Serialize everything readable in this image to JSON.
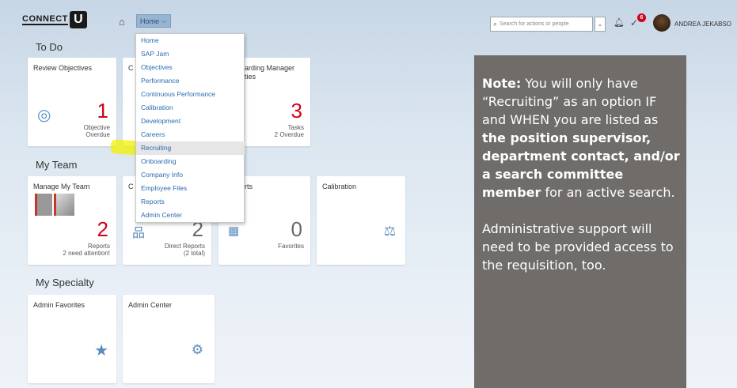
{
  "header": {
    "logo_text": "CONNECT",
    "logo_letter": "U",
    "home_label": "Home",
    "search_placeholder": "Search for actions or people",
    "notification_badge": "6",
    "user_name": "ANDREA JEKABSO"
  },
  "home_menu": {
    "items": [
      "Home",
      "SAP Jam",
      "Objectives",
      "Performance",
      "Continuous Performance",
      "Calibration",
      "Development",
      "Careers",
      "Recruiting",
      "Onboarding",
      "Company Info",
      "Employee Files",
      "Reports",
      "Admin Center"
    ],
    "selected": "Recruiting"
  },
  "sections": {
    "todo": "To Do",
    "team": "My Team",
    "specialty": "My Specialty"
  },
  "tiles": {
    "review_objectives": {
      "title": "Review Objectives",
      "value": "1",
      "sub1": "Objective",
      "sub2": "Overdue"
    },
    "todo_c": {
      "title_fragment": "C"
    },
    "onboarding_manager": {
      "title_line1": "arding Manager",
      "title_line2": "ties",
      "value": "3",
      "sub1": "Tasks",
      "sub2": "2 Overdue"
    },
    "manage_team": {
      "title": "Manage My Team",
      "value": "2",
      "sub1": "Reports",
      "sub2": "2 need attention!"
    },
    "direct_reports": {
      "title_fragment": "C",
      "value": "2",
      "sub1": "Direct Reports",
      "sub2": "(2 total)"
    },
    "reports": {
      "title_fragment": "rts",
      "value": "0",
      "sub1": "Favorites"
    },
    "calibration": {
      "title": "Calibration"
    },
    "admin_favorites": {
      "title": "Admin Favorites"
    },
    "admin_center": {
      "title": "Admin Center"
    }
  },
  "note": {
    "p1_label": "Note:",
    "p1_a": " You will only have “Recruiting” as an option IF and WHEN you are listed as ",
    "p1_bold": "the position supervisor, department contact, and/or a search committee member",
    "p1_b": " for an active search.",
    "p2": "Administrative support will need to be provided access to the requisition, too."
  },
  "colors": {
    "accent_red": "#d0021b",
    "link_blue": "#2a6cb0",
    "note_bg": "#706c6a",
    "highlighter": "#f2f200"
  }
}
